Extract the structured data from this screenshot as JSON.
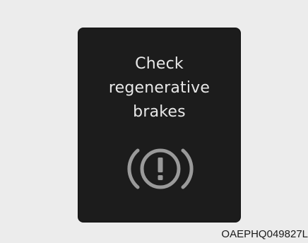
{
  "warning": {
    "lines": [
      "Check",
      "regenerative",
      "brakes"
    ],
    "icon": "brake-warning-icon"
  },
  "caption": {
    "code": "OAEPHQ049827L"
  },
  "colors": {
    "background": "#ececec",
    "panel": "#1c1c1c",
    "text": "#e8e8e8",
    "icon": "#9a9a9a"
  }
}
